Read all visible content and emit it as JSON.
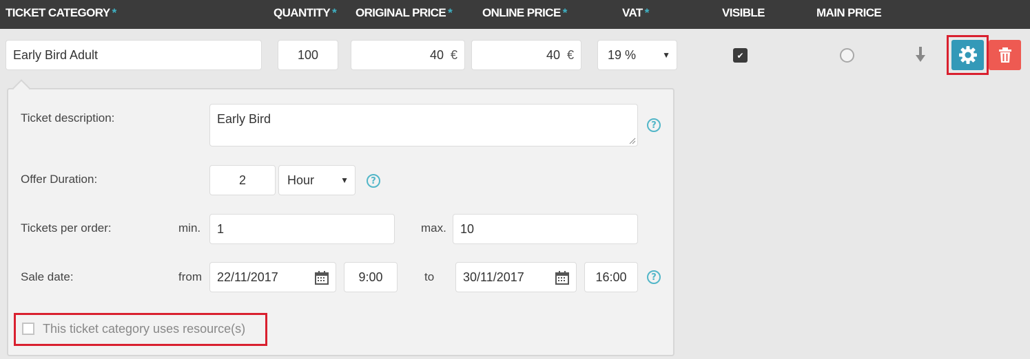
{
  "header": {
    "columns": {
      "ticket_category": "TICKET CATEGORY",
      "quantity": "QUANTITY",
      "original_price": "ORIGINAL PRICE",
      "online_price": "ONLINE PRICE",
      "vat": "VAT",
      "visible": "VISIBLE",
      "main_price": "MAIN PRICE"
    },
    "required_marker": "*"
  },
  "row": {
    "ticket_category": "Early Bird Adult",
    "quantity": "100",
    "original_price": "40",
    "online_price": "40",
    "currency": "€",
    "vat": "19 %",
    "visible_checked": true,
    "main_price_selected": false
  },
  "details": {
    "description_label": "Ticket description:",
    "description_value": "Early Bird",
    "duration_label": "Offer Duration:",
    "duration_value": "2",
    "duration_unit": "Hour",
    "tickets_label": "Tickets per order:",
    "min_label": "min.",
    "min_value": "1",
    "max_label": "max.",
    "max_value": "10",
    "sale_label": "Sale date:",
    "from_label": "from",
    "from_date": "22/11/2017",
    "from_time": "9:00",
    "to_label": "to",
    "to_date": "30/11/2017",
    "to_time": "16:00",
    "resource_label": "This ticket category uses resource(s)",
    "resource_checked": false,
    "help_glyph": "?"
  },
  "colors": {
    "header_bg": "#3b3b3b",
    "accent": "#3fb3c6",
    "settings_button": "#3399b8",
    "delete_button": "#ee5a52",
    "highlight": "#d9202f"
  },
  "icons": [
    "checkbox-checked-icon",
    "radio-icon",
    "sort-arrow-down-icon",
    "gear-icon",
    "trash-icon",
    "calendar-icon",
    "help-icon",
    "caret-down-icon"
  ]
}
